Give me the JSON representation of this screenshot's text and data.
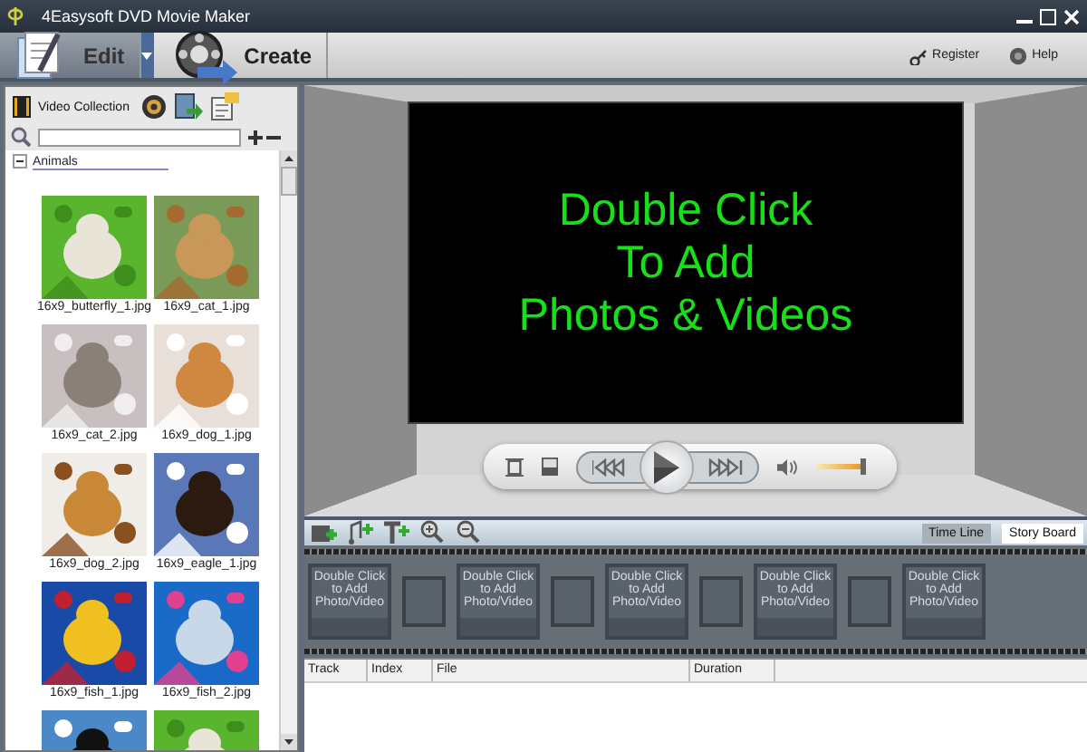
{
  "window": {
    "title": "4Easysoft DVD Movie Maker"
  },
  "toolbar": {
    "modes": [
      {
        "label": "Edit",
        "selected": true
      },
      {
        "label": "Create",
        "selected": false
      }
    ],
    "links": [
      "Register",
      "Help"
    ]
  },
  "collection": {
    "tab": "Video Collection",
    "group": {
      "label": "Animals",
      "expanded": true
    },
    "items": [
      {
        "kind": "captioned",
        "caption": "16x9_butterfly_1.jpg"
      },
      {
        "kind": "captioned",
        "caption": "16x9_cat_1.jpg"
      },
      {
        "kind": "captioned",
        "caption": "16x9_cat_2.jpg"
      },
      {
        "kind": "captioned",
        "caption": "16x9_dog_1.jpg"
      },
      {
        "kind": "captioned",
        "caption": "16x9_dog_2.jpg"
      },
      {
        "kind": "captioned",
        "caption": "16x9_eagle_1.jpg"
      },
      {
        "kind": "captioned",
        "caption": "16x9_fish_1.jpg"
      },
      {
        "kind": "captioned",
        "caption": "16x9_fish_2.jpg"
      },
      {
        "kind": "picture"
      },
      {
        "kind": "picture"
      }
    ]
  },
  "preview": {
    "message": [
      "Double Click",
      "To Add",
      "Photos & Videos"
    ],
    "volume": {
      "level": 0.85
    }
  },
  "storyboard": {
    "tabs": [
      {
        "label": "Time Line",
        "selected": false
      },
      {
        "label": "Story Board",
        "selected": true
      }
    ],
    "slots": [
      {
        "text": "Double Click to Add Photo/Video"
      },
      {
        "text": "Double Click to Add Photo/Video"
      },
      {
        "text": "Double Click to Add Photo/Video"
      },
      {
        "text": "Double Click to Add Photo/Video"
      },
      {
        "text": "Double Click to Add Photo/Video"
      }
    ]
  },
  "table": {
    "columns": [
      "Track",
      "Index",
      "File",
      "Duration"
    ]
  }
}
